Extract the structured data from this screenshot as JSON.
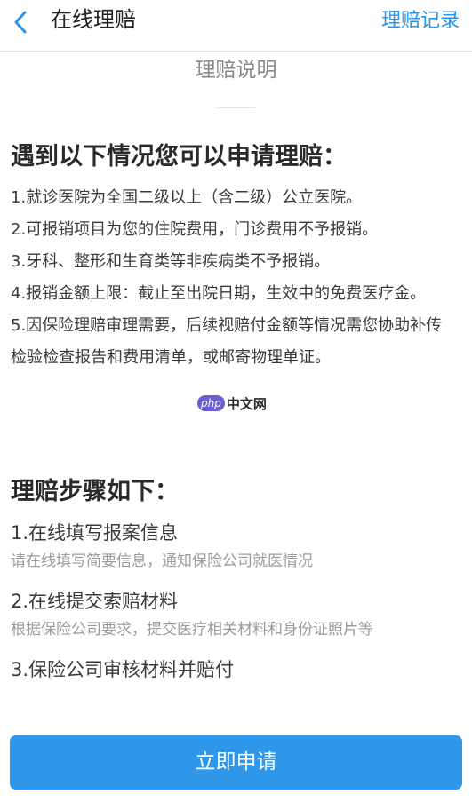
{
  "header": {
    "title": "在线理赔",
    "records_link": "理赔记录",
    "back_icon": "chevron-left-icon"
  },
  "subtitle": "理赔说明",
  "conditions": {
    "heading": "遇到以下情况您可以申请理赔：",
    "items": [
      "1.就诊医院为全国二级以上（含二级）公立医院。",
      "2.可报销项目为您的住院费用，门诊费用不予报销。",
      "3.牙科、整形和生育类等非疾病类不予报销。",
      "4.报销金额上限：截止至出院日期，生效中的免费医疗金。",
      "5.因保险理赔审理需要，后续视赔付金额等情况需您协助补传检验检查报告和费用清单，或邮寄物理单证。"
    ]
  },
  "steps": {
    "heading": "理赔步骤如下：",
    "items": [
      {
        "title": "1.在线填写报案信息",
        "desc": "请在线填写简要信息，通知保险公司就医情况"
      },
      {
        "title": "2.在线提交索赔材料",
        "desc": "根据保险公司要求，提交医疗相关材料和身份证照片等"
      },
      {
        "title": "3.保险公司审核材料并赔付",
        "desc": ""
      }
    ]
  },
  "apply_button": "立即申请",
  "watermark": {
    "badge": "php",
    "text": "中文网"
  },
  "colors": {
    "accent": "#2f97ea",
    "link": "#2b95e9"
  }
}
